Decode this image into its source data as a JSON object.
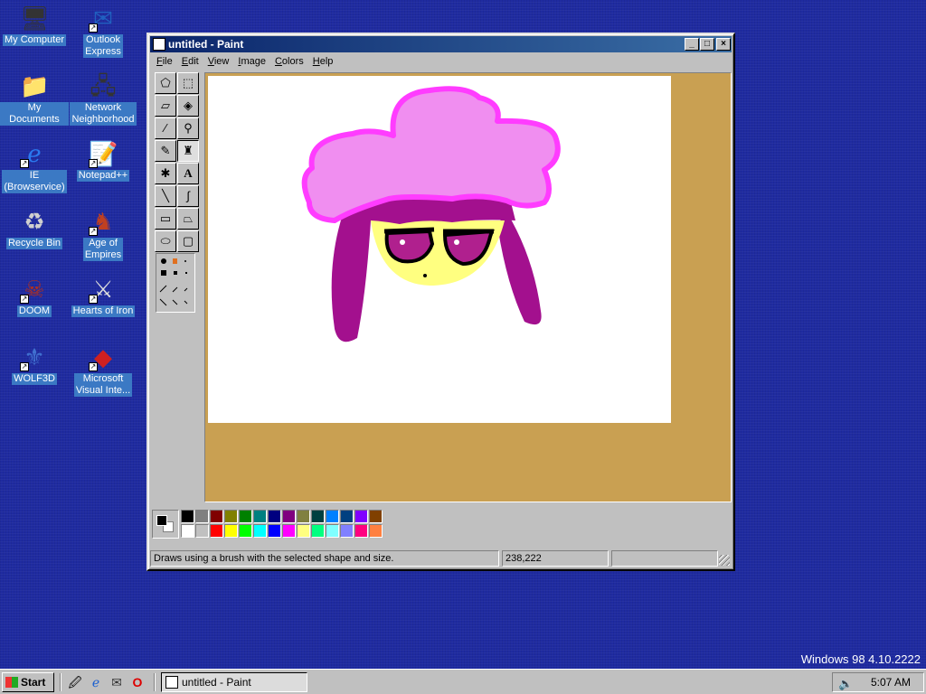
{
  "desktop": {
    "icons": [
      {
        "label": "My Computer",
        "icon": "computer-icon"
      },
      {
        "label": "Outlook\nExpress",
        "icon": "outlook-express-icon"
      },
      {
        "label": "My Documents",
        "icon": "folder-icon"
      },
      {
        "label": "Network\nNeighborhood",
        "icon": "network-icon"
      },
      {
        "label": "IE\n(Browservice)",
        "icon": "internet-explorer-icon"
      },
      {
        "label": "Notepad++",
        "icon": "notepad-icon"
      },
      {
        "label": "Recycle Bin",
        "icon": "recycle-bin-icon"
      },
      {
        "label": "Age of\nEmpires",
        "icon": "age-of-empires-icon"
      },
      {
        "label": "DOOM",
        "icon": "doom-icon"
      },
      {
        "label": "Hearts of Iron",
        "icon": "hearts-of-iron-icon"
      },
      {
        "label": "WOLF3D",
        "icon": "wolf3d-icon"
      },
      {
        "label": "Microsoft\nVisual Inte...",
        "icon": "visual-interdev-icon"
      }
    ],
    "version_text": "Windows 98 4.10.2222"
  },
  "paint": {
    "title": "untitled - Paint",
    "menus": [
      "File",
      "Edit",
      "View",
      "Image",
      "Colors",
      "Help"
    ],
    "status_text": "Draws using a brush with the selected shape and size.",
    "coordinates": "238,222",
    "colors": {
      "canvas_bg": "#c9a052",
      "hat_fill": "#f08ef0",
      "hat_outline": "#ff3cff",
      "hair": "#a3108e",
      "face": "#ffff80",
      "eye": "#b0208e"
    },
    "palette": [
      "#000000",
      "#808080",
      "#800000",
      "#808000",
      "#008000",
      "#008080",
      "#000080",
      "#800080",
      "#808040",
      "#004040",
      "#0080ff",
      "#004080",
      "#8000ff",
      "#804000",
      "#ffffff",
      "#c0c0c0",
      "#ff0000",
      "#ffff00",
      "#00ff00",
      "#00ffff",
      "#0000ff",
      "#ff00ff",
      "#ffff80",
      "#00ff80",
      "#80ffff",
      "#8080ff",
      "#ff0080",
      "#ff8040"
    ]
  },
  "taskbar": {
    "start_label": "Start",
    "task_label": "untitled - Paint",
    "clock": "5:07 AM"
  }
}
